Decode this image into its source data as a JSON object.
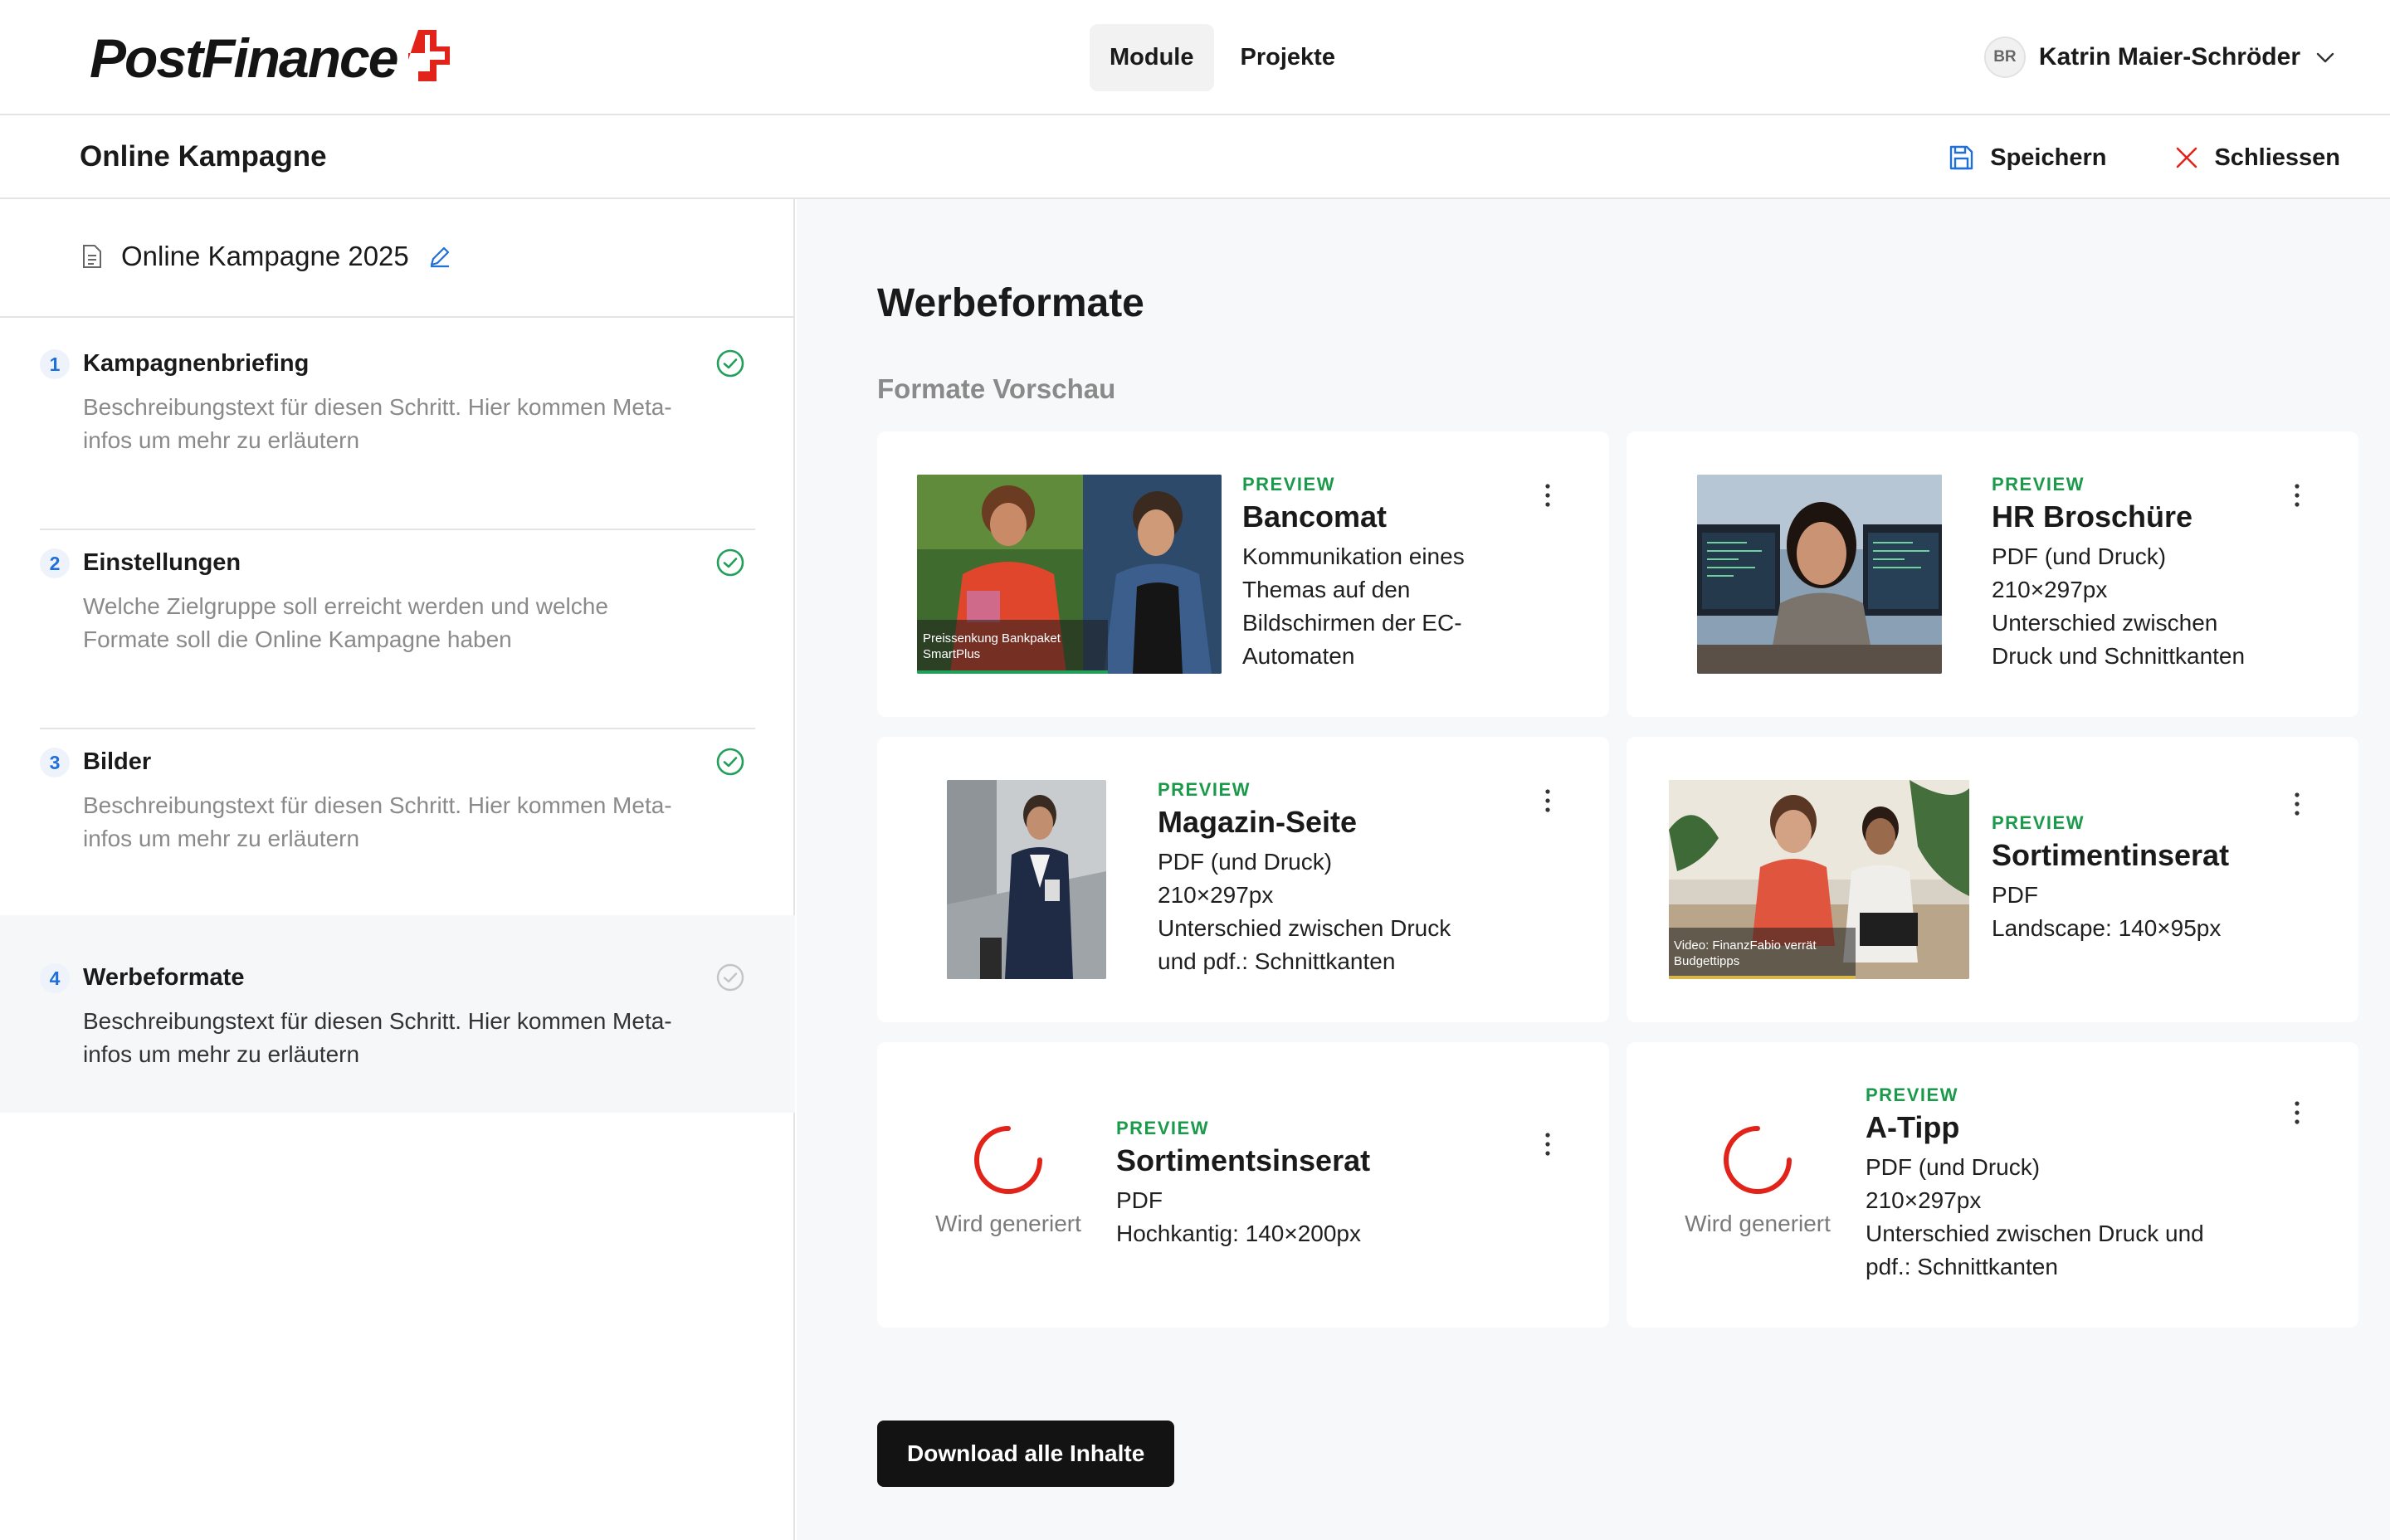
{
  "header": {
    "logo_text": "PostFinance",
    "nav": [
      {
        "label": "Module",
        "active": true
      },
      {
        "label": "Projekte",
        "active": false
      }
    ],
    "user": {
      "initials": "BR",
      "name": "Katrin Maier-Schröder"
    }
  },
  "subbar": {
    "title": "Online Kampagne",
    "save_label": "Speichern",
    "close_label": "Schliessen"
  },
  "sidebar": {
    "document_title": "Online Kampagne 2025",
    "steps": [
      {
        "number": "1",
        "title": "Kampagnenbriefing",
        "description": "Beschreibungstext für diesen Schritt. Hier kommen Meta-infos um mehr zu erläutern",
        "status": "completed"
      },
      {
        "number": "2",
        "title": "Einstellungen",
        "description": "Welche Zielgruppe soll erreicht werden und welche Formate soll die Online Kampagne haben",
        "status": "completed"
      },
      {
        "number": "3",
        "title": "Bilder",
        "description": "Beschreibungstext für diesen Schritt. Hier kommen Meta-infos um mehr zu erläutern",
        "status": "completed"
      },
      {
        "number": "4",
        "title": "Werbeformate",
        "description": "Beschreibungstext für diesen Schritt. Hier kommen Meta-infos um mehr zu erläutern",
        "status": "active"
      }
    ]
  },
  "main": {
    "title": "Werbeformate",
    "section_title": "Formate Vorschau",
    "cards": [
      {
        "kicker": "PREVIEW",
        "title": "Bancomat",
        "lines": [
          "Kommunikation eines",
          "Themas auf den",
          "Bildschirmen der EC-",
          "Automaten"
        ],
        "thumb_caption": [
          "Preissenkung Bankpaket",
          "SmartPlus"
        ]
      },
      {
        "kicker": "PREVIEW",
        "title": "HR Broschüre",
        "lines": [
          "PDF (und Druck)",
          "210×297px",
          "Unterschied zwischen",
          "Druck und Schnittkanten"
        ]
      },
      {
        "kicker": "PREVIEW",
        "title": "Magazin-Seite",
        "lines": [
          "PDF (und Druck)",
          "210×297px",
          "Unterschied zwischen Druck",
          "und pdf.: Schnittkanten"
        ]
      },
      {
        "kicker": "PREVIEW",
        "title": "Sortimentinserat",
        "lines": [
          "PDF",
          "Landscape: 140×95px"
        ],
        "thumb_caption": [
          "Video: FinanzFabio verrät",
          "Budgettipps"
        ]
      },
      {
        "kicker": "PREVIEW",
        "title": "Sortimentsinserat",
        "lines": [
          "PDF",
          "Hochkantig: 140×200px"
        ],
        "status": "Wird generiert"
      },
      {
        "kicker": "PREVIEW",
        "title": "A-Tipp",
        "lines": [
          "PDF (und Druck)",
          "210×297px",
          "Unterschied zwischen Druck und",
          "pdf.: Schnittkanten"
        ],
        "status": "Wird generiert"
      }
    ],
    "download_label": "Download alle Inhalte"
  },
  "colors": {
    "brand_red": "#e2231a",
    "preview_green": "#1a9a4a",
    "check_green": "#22a05a",
    "link_blue": "#1f6fd8",
    "dark_button": "#131313"
  },
  "icons": [
    "swiss-cross-logo-icon",
    "chevron-down-icon",
    "save-icon",
    "close-icon",
    "document-icon",
    "edit-pencil-icon",
    "check-circle-icon",
    "kebab-menu-icon",
    "spinner-icon"
  ]
}
